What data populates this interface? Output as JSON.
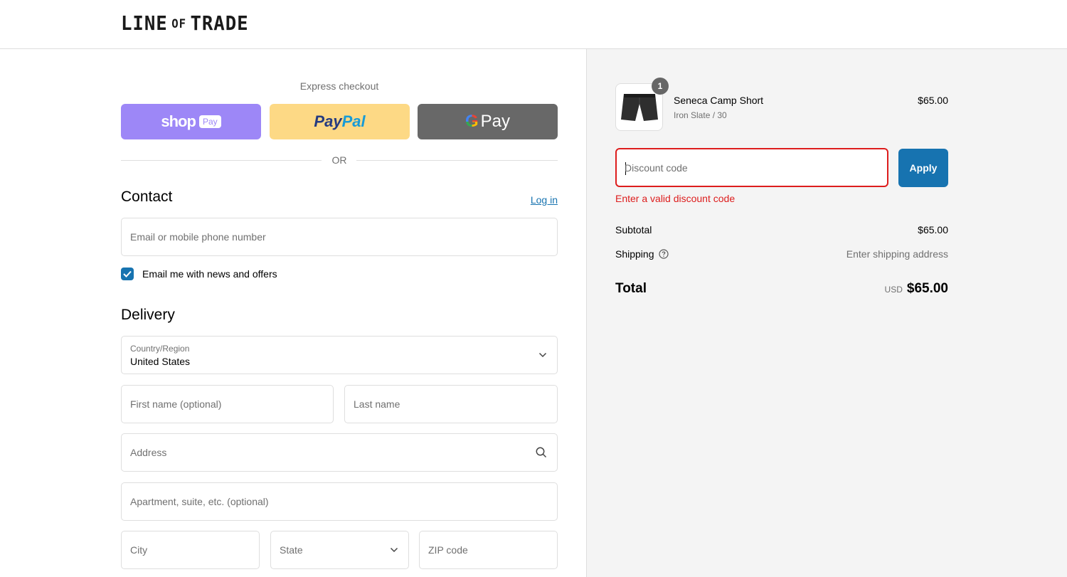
{
  "header": {
    "logo_line": "LINE",
    "logo_of": "OF",
    "logo_trade": "TRADE"
  },
  "express": {
    "title": "Express checkout",
    "shop_label": "shop",
    "shop_badge": "Pay",
    "paypal_part1": "Pay",
    "paypal_part2": "Pal",
    "gpay_g": "G",
    "gpay_label": "Pay",
    "or_label": "OR"
  },
  "contact": {
    "heading": "Contact",
    "login_label": "Log in",
    "email_placeholder": "Email or mobile phone number",
    "newsletter_label": "Email me with news and offers",
    "newsletter_checked": true
  },
  "delivery": {
    "heading": "Delivery",
    "country_label": "Country/Region",
    "country_value": "United States",
    "first_name_placeholder": "First name (optional)",
    "last_name_placeholder": "Last name",
    "address_placeholder": "Address",
    "apartment_placeholder": "Apartment, suite, etc. (optional)",
    "city_placeholder": "City",
    "state_placeholder": "State",
    "zip_placeholder": "ZIP code"
  },
  "order": {
    "item": {
      "quantity": "1",
      "name": "Seneca Camp Short",
      "variant": "Iron Slate / 30",
      "price": "$65.00",
      "image_icon": "shorts-icon"
    },
    "discount_placeholder": "Discount code",
    "apply_label": "Apply",
    "discount_error": "Enter a valid discount code",
    "subtotal_label": "Subtotal",
    "subtotal_value": "$65.00",
    "shipping_label": "Shipping",
    "shipping_value": "Enter shipping address",
    "total_label": "Total",
    "total_currency": "USD",
    "total_value": "$65.00"
  },
  "colors": {
    "accent": "#1773b0",
    "error": "#dd1d1d",
    "shop_pay": "#9d87f7",
    "paypal": "#fdd985",
    "gpay": "#686868"
  }
}
